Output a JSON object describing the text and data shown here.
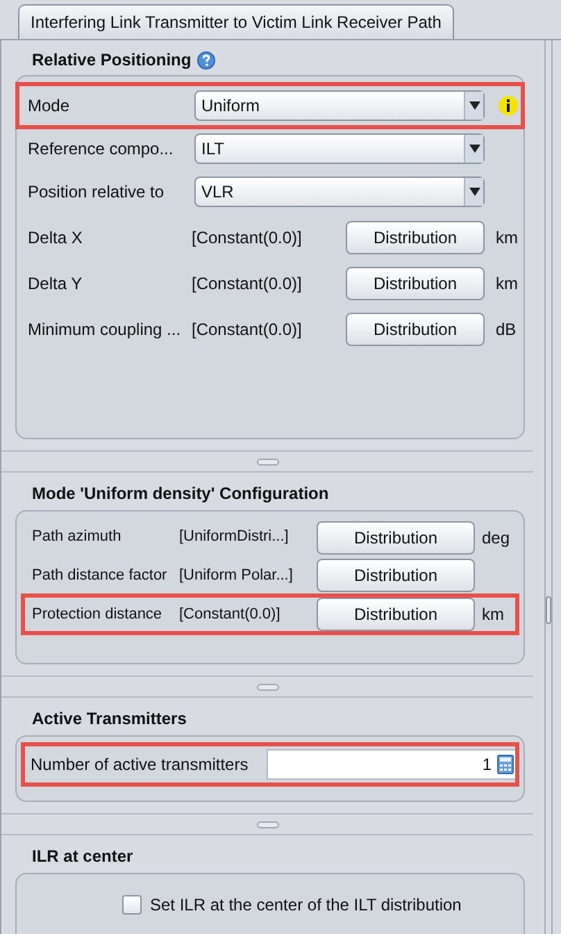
{
  "tab": {
    "label": "Interfering Link Transmitter to Victim Link Receiver Path",
    "selected": true
  },
  "sections": [
    {
      "title": "Relative Positioning",
      "help": true,
      "rows": [
        {
          "kind": "combo",
          "label": "Mode",
          "value": "Uniform",
          "highlighted": true,
          "info": true
        },
        {
          "kind": "combo",
          "label": "Reference compo...",
          "value": "ILT"
        },
        {
          "kind": "combo",
          "label": "Position relative to",
          "value": "VLR"
        },
        {
          "kind": "distribution",
          "label": "Delta X",
          "value": "[Constant(0.0)]",
          "button": "Distribution",
          "unit": "km"
        },
        {
          "kind": "distribution",
          "label": "Delta Y",
          "value": "[Constant(0.0)]",
          "button": "Distribution",
          "unit": "km"
        },
        {
          "kind": "distribution",
          "label": "Minimum coupling ...",
          "value": "[Constant(0.0)]",
          "button": "Distribution",
          "unit": "dB"
        }
      ]
    },
    {
      "title": "Mode 'Uniform density' Configuration",
      "rows": [
        {
          "kind": "distribution",
          "label": "Path azimuth",
          "value": "[UniformDistri...]",
          "button": "Distribution",
          "unit": "deg"
        },
        {
          "kind": "distribution",
          "label": "Path distance factor",
          "value": "[Uniform Polar...]",
          "button": "Distribution"
        },
        {
          "kind": "distribution",
          "label": "Protection distance",
          "value": "[Constant(0.0)]",
          "button": "Distribution",
          "unit": "km",
          "highlighted": true
        }
      ]
    },
    {
      "title": "Active Transmitters",
      "rows": [
        {
          "kind": "number",
          "label": "Number of active transmitters",
          "value": "1",
          "highlighted": true
        }
      ]
    },
    {
      "title": "ILR at center",
      "rows": [
        {
          "kind": "checkbox",
          "label": "Set ILR at the center of the ILT distribution",
          "checked": false
        }
      ]
    }
  ]
}
